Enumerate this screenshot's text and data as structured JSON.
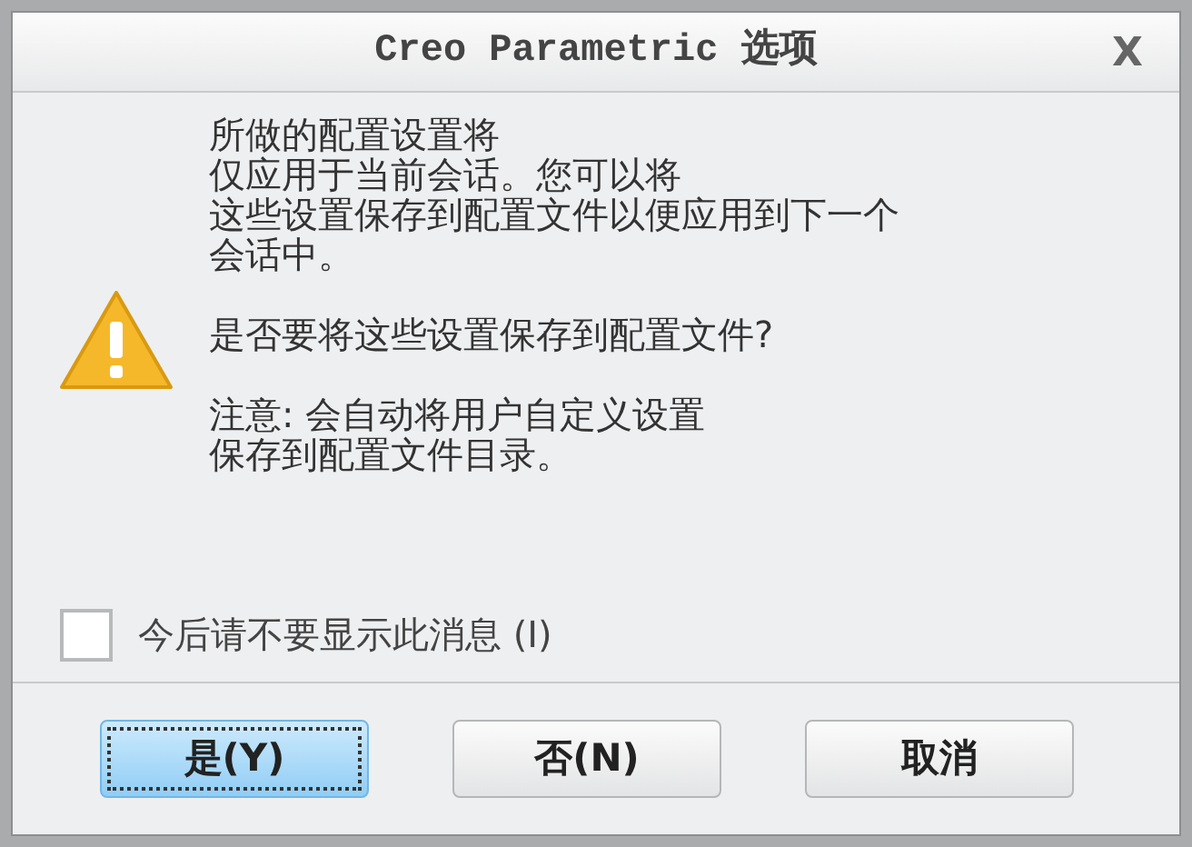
{
  "window": {
    "title": "Creo Parametric 选项",
    "close": "X"
  },
  "message": {
    "paragraphs": [
      [
        "所做的配置设置将",
        "仅应用于当前会话。您可以将",
        "这些设置保存到配置文件以便应用到下一个",
        "会话中。"
      ],
      [
        "是否要将这些设置保存到配置文件?"
      ],
      [
        "注意: 会自动将用户自定义设置",
        "保存到配置文件目录。"
      ]
    ]
  },
  "checkbox": {
    "label": "今后请不要显示此消息 (I)",
    "checked": false
  },
  "buttons": [
    {
      "label": "是(Y)",
      "focused": true
    },
    {
      "label": "否(N)",
      "focused": false
    },
    {
      "label": "取消",
      "focused": false
    }
  ]
}
